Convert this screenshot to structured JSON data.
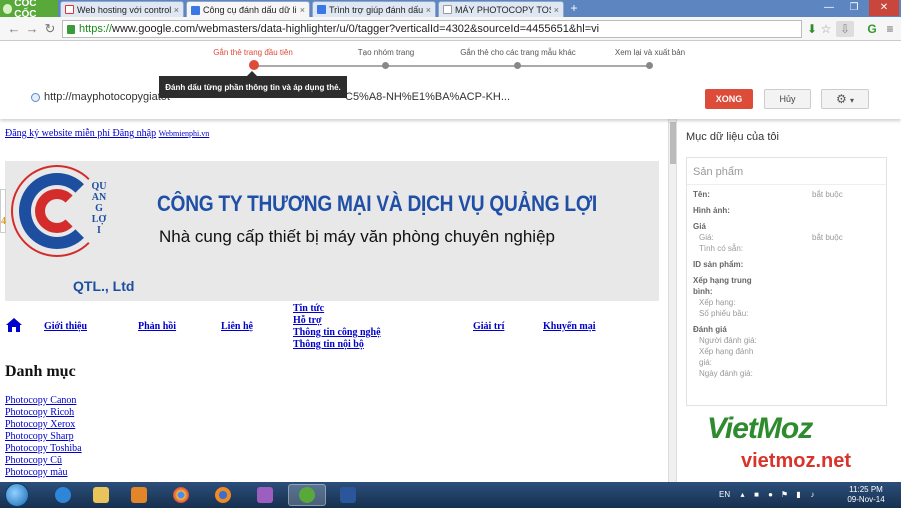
{
  "browser": {
    "logo_text": "CỐC CỐC",
    "tabs": [
      {
        "title": "Web hosting với control pa",
        "icon": "gmail-icon",
        "active": false
      },
      {
        "title": "Công cụ đánh dấu dữ liệu",
        "icon": "google-icon",
        "active": true
      },
      {
        "title": "Trình trợ giúp đánh dấu dữ",
        "icon": "google-icon",
        "active": false
      },
      {
        "title": "MÁY PHOTOCOPY TOSHIB",
        "icon": "document-icon",
        "active": false
      }
    ],
    "tab_close": "×",
    "new_tab": "+",
    "window_controls": {
      "minimize": "—",
      "maximize": "❐",
      "close": "✕"
    },
    "nav": {
      "back": "←",
      "forward": "→",
      "reload": "↻"
    },
    "address": {
      "scheme": "https://",
      "rest": "www.google.com/webmasters/data-highlighter/u/0/tagger?verticalId=4302&sourceId=4455651&hl=vi"
    }
  },
  "tagger": {
    "steps": [
      {
        "label": "Gắn thẻ trang đầu tiên",
        "active": true
      },
      {
        "label": "Tạo nhóm trang",
        "active": false
      },
      {
        "label": "Gắn thẻ cho các trang mẫu khác",
        "active": false
      },
      {
        "label": "Xem lại và xuất bản",
        "active": false
      }
    ],
    "tooltip": "Đánh dấu từng phần thông tin và áp dụng thẻ.",
    "page_url_a": "http://mayphotocopygiatot",
    "page_url_b": "C5%A8-NH%E1%BA%ACP-KH...",
    "done_label": "XONG",
    "cancel_label": "Hủy",
    "gear_caret": "▾"
  },
  "site": {
    "top_link": "Đăng ký website miễn phí Đăng nhập",
    "top_link_small": "Webmienphi.vn",
    "logo_arc_text": "QUANG LỢI",
    "logo_sub": "QTL., Ltd",
    "left_stub": "4",
    "banner_title": "CÔNG TY THƯƠNG MẠI VÀ DỊCH VỤ QUẢNG LỢI",
    "banner_subtitle": "Nhà cung cấp thiết bị máy văn phòng chuyên nghiệp",
    "nav": [
      {
        "label": "Giới thiệu"
      },
      {
        "label": "Phản hồi"
      },
      {
        "label": "Liên hệ"
      },
      {
        "label": "Giải trí"
      },
      {
        "label": "Khuyến mại"
      }
    ],
    "nav_sub": [
      "Tin tức",
      "Hỗ trợ",
      "Thông tin công nghệ",
      "Thông tin nội bộ"
    ],
    "category_title": "Danh mục",
    "categories": [
      "Photocopy Canon",
      "Photocopy Ricoh",
      "Photocopy Xerox",
      "Photocopy Sharp",
      "Photocopy Toshiba",
      "Photocopy Cũ",
      "Photocopy màu"
    ]
  },
  "panel": {
    "title": "Mục dữ liệu của tôi",
    "section": "Sản phẩm",
    "fields": [
      {
        "label": "Tên:",
        "kind": "lbl",
        "value": "bắt buộc"
      },
      {
        "label": "Hình ảnh:",
        "kind": "lbl",
        "value": ""
      },
      {
        "label": "Giá",
        "kind": "lbl",
        "value": ""
      },
      {
        "label": "Giá:",
        "kind": "sub",
        "value": "bắt buộc"
      },
      {
        "label": "Tình có sẵn:",
        "kind": "sub",
        "value": ""
      },
      {
        "label": "ID sản phẩm:",
        "kind": "lbl",
        "value": ""
      },
      {
        "label": "Xếp hạng trung",
        "kind": "lbl",
        "value": ""
      },
      {
        "label": "bình:",
        "kind": "lbl",
        "value": ""
      },
      {
        "label": "Xếp hạng:",
        "kind": "sub",
        "value": ""
      },
      {
        "label": "Số phiếu bầu:",
        "kind": "sub",
        "value": ""
      },
      {
        "label": "Đánh giá",
        "kind": "lbl",
        "value": ""
      },
      {
        "label": "Người đánh giá:",
        "kind": "sub",
        "value": ""
      },
      {
        "label": "Xếp hạng đánh",
        "kind": "sub",
        "value": ""
      },
      {
        "label": "giá:",
        "kind": "sub",
        "value": ""
      },
      {
        "label": "Ngày đánh giá:",
        "kind": "sub",
        "value": ""
      }
    ]
  },
  "watermark": {
    "main": "VietMoz",
    "url": "vietmoz.net"
  },
  "taskbar": {
    "language": "EN",
    "time": "11:25 PM",
    "date": "09-Nov-14"
  }
}
